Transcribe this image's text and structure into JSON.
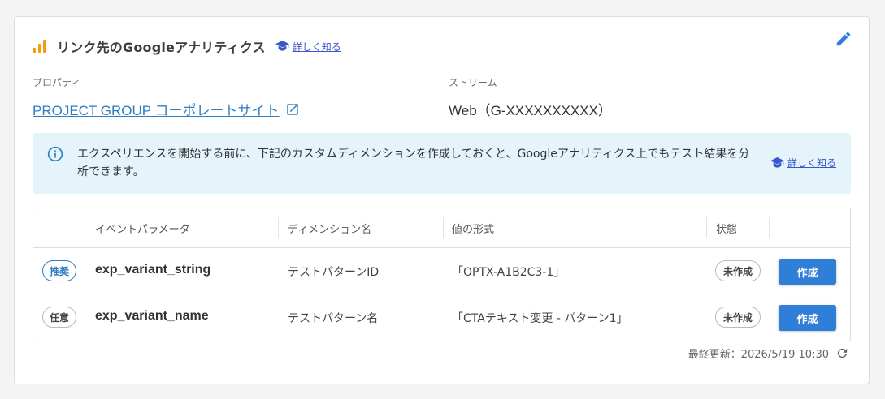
{
  "header": {
    "title": "リンク先のGoogleアナリティクス",
    "learn_more": "詳しく知る"
  },
  "property": {
    "label": "プロパティ",
    "name": "PROJECT GROUP コーポレートサイト"
  },
  "stream": {
    "label": "ストリーム",
    "value": "Web（G-XXXXXXXXXX）"
  },
  "info": {
    "text": "エクスペリエンスを開始する前に、下記のカスタムディメンションを作成しておくと、Googleアナリティクス上でもテスト結果を分析できます。",
    "learn_more": "詳しく知る"
  },
  "table": {
    "headers": [
      "イベントパラメータ",
      "ディメンション名",
      "値の形式",
      "状態"
    ],
    "rows": [
      {
        "tag": "推奨",
        "param": "exp_variant_string",
        "dimension": "テストパターンID",
        "format": "「OPTX-A1B2C3-1」",
        "status": "未作成",
        "action": "作成"
      },
      {
        "tag": "任意",
        "param": "exp_variant_name",
        "dimension": "テストパターン名",
        "format": "「CTAテキスト変更 - パターン1」",
        "status": "未作成",
        "action": "作成"
      }
    ]
  },
  "footer": {
    "updated": "最終更新：2026/5/19 10:30"
  },
  "colors": {
    "accent": "#2f7ed8",
    "link": "#3a55c9",
    "chart_icon": "#f39c12",
    "info_bg": "#e5f4fb"
  }
}
